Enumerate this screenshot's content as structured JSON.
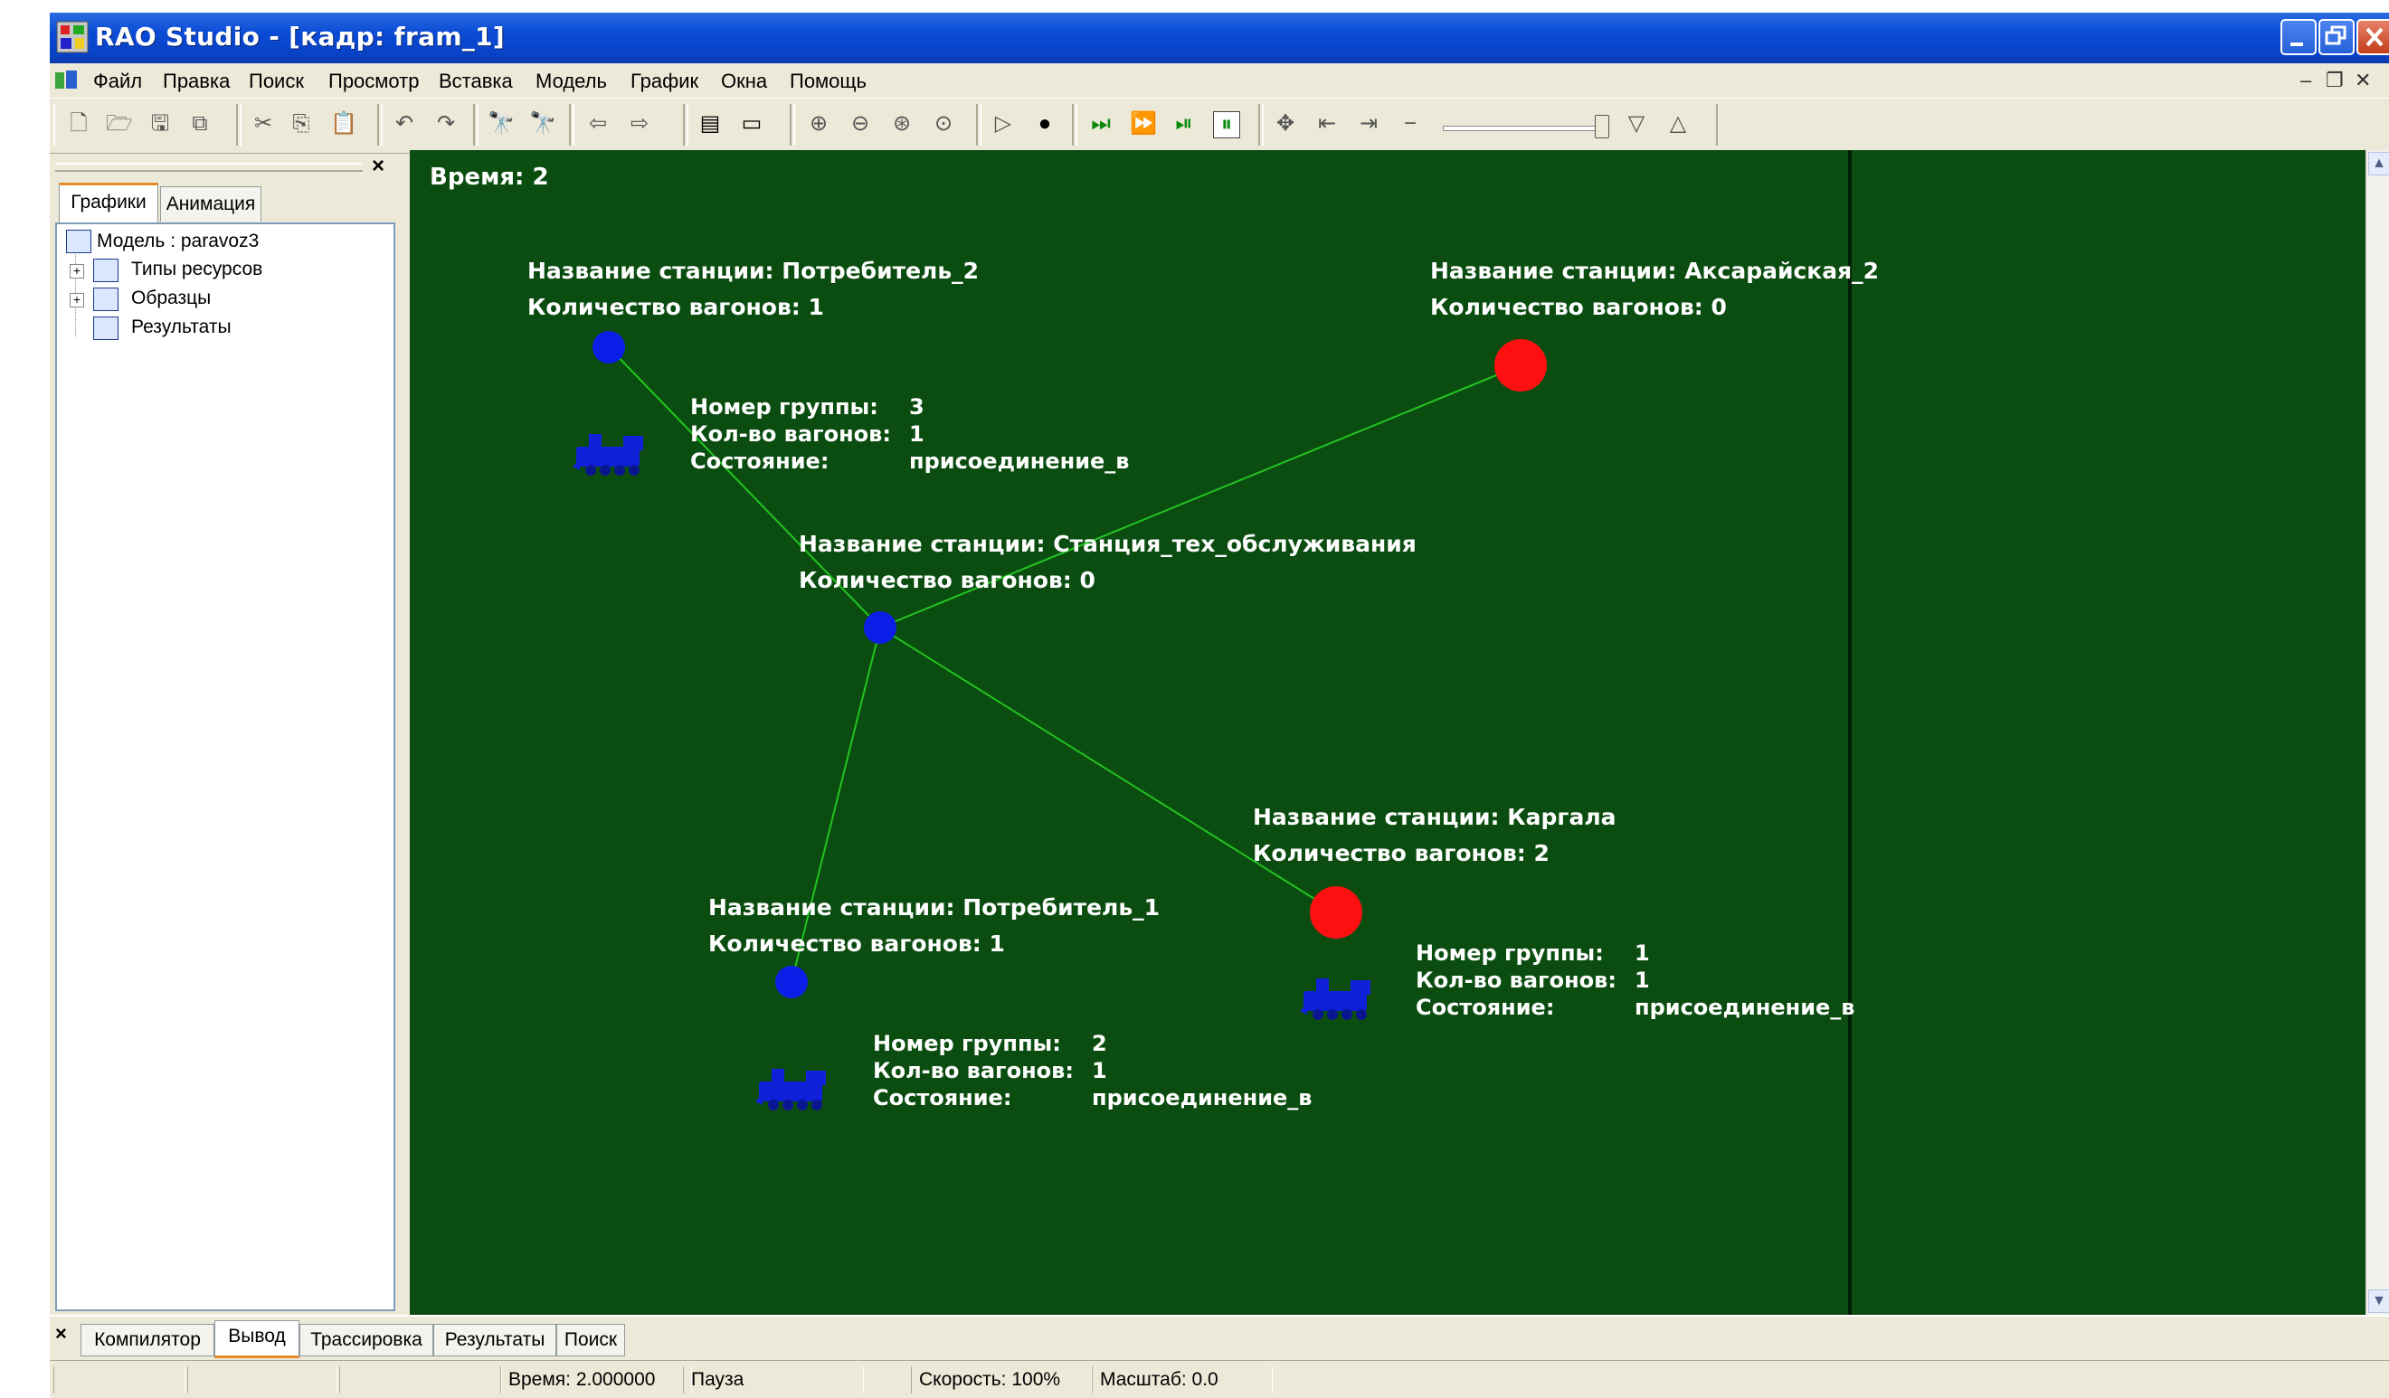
{
  "window": {
    "title": "RAO Studio - [кадр: fram_1]",
    "controls": [
      "minimize",
      "maximize",
      "close"
    ]
  },
  "menu": [
    "Файл",
    "Правка",
    "Поиск",
    "Просмотр",
    "Вставка",
    "Модель",
    "График",
    "Окна",
    "Помощь"
  ],
  "left_panel": {
    "tabs": [
      "Графики",
      "Анимация"
    ],
    "active_tab": "Графики",
    "tree": {
      "root": "Модель : paravoz3",
      "children": [
        "Типы ресурсов",
        "Образцы",
        "Результаты"
      ]
    }
  },
  "frame": {
    "time_label": "Время: 2",
    "background": "#0b4d10",
    "link_color": "#22c422",
    "text_color": "#ffffff",
    "station_label_prefix": "Название станции: ",
    "wagons_label_prefix": "Количество вагонов: ",
    "stations": [
      {
        "name": "Потребитель_2",
        "wagons": "1",
        "color": "#0a1ee8"
      },
      {
        "name": "Аксарайская_2",
        "wagons": "0",
        "color": "#ff1010"
      },
      {
        "name": "Станция_тех_обслуживания",
        "wagons": "0",
        "color": "#0a1ee8"
      },
      {
        "name": "Каргала",
        "wagons": "2",
        "color": "#ff1010"
      },
      {
        "name": "Потребитель_1",
        "wagons": "1",
        "color": "#0a1ee8"
      }
    ],
    "group_labels": {
      "number": "Номер группы:",
      "wagons": "Кол-во вагонов:",
      "state": "Состояние:"
    },
    "groups": [
      {
        "number": "3",
        "wagons": "1",
        "state": "присоединение_в"
      },
      {
        "number": "1",
        "wagons": "1",
        "state": "присоединение_в"
      },
      {
        "number": "2",
        "wagons": "1",
        "state": "присоединение_в"
      }
    ]
  },
  "bottom_tabs": [
    "Компилятор",
    "Вывод",
    "Трассировка",
    "Результаты",
    "Поиск"
  ],
  "active_bottom_tab": "Вывод",
  "status_bar": {
    "time": "Время: 2.000000",
    "state": "Пауза",
    "speed": "Скорость: 100%",
    "scale": "Масштаб: 0.0"
  }
}
